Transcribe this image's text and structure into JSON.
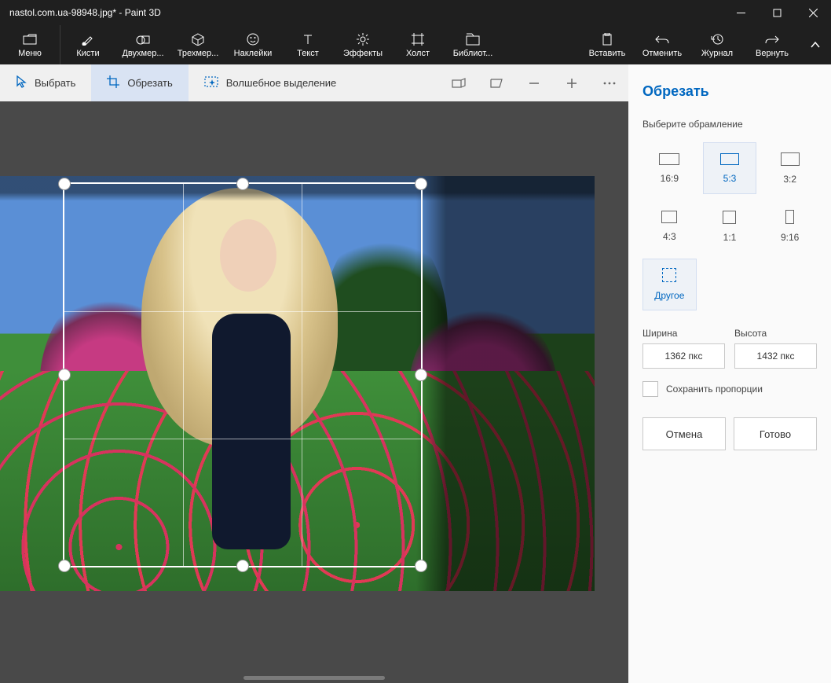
{
  "window": {
    "title": "nastol.com.ua-98948.jpg* - Paint 3D"
  },
  "ribbon": {
    "menu": "Меню",
    "brushes": "Кисти",
    "shapes2d": "Двухмер...",
    "shapes3d": "Трехмер...",
    "stickers": "Наклейки",
    "text": "Текст",
    "effects": "Эффекты",
    "canvas": "Холст",
    "library": "Библиот...",
    "paste": "Вставить",
    "undo": "Отменить",
    "history": "Журнал",
    "redo": "Вернуть"
  },
  "toolbar": {
    "select": "Выбрать",
    "crop": "Обрезать",
    "magic": "Волшебное выделение"
  },
  "panel": {
    "title": "Обрезать",
    "frame_label": "Выберите обрамление",
    "presets": {
      "p169": "16:9",
      "p53": "5:3",
      "p32": "3:2",
      "p43": "4:3",
      "p11": "1:1",
      "p916": "9:16",
      "other": "Другое"
    },
    "width_label": "Ширина",
    "height_label": "Высота",
    "width_value": "1362 пкс",
    "height_value": "1432 пкс",
    "lock_ratio": "Сохранить пропорции",
    "cancel": "Отмена",
    "done": "Готово"
  }
}
